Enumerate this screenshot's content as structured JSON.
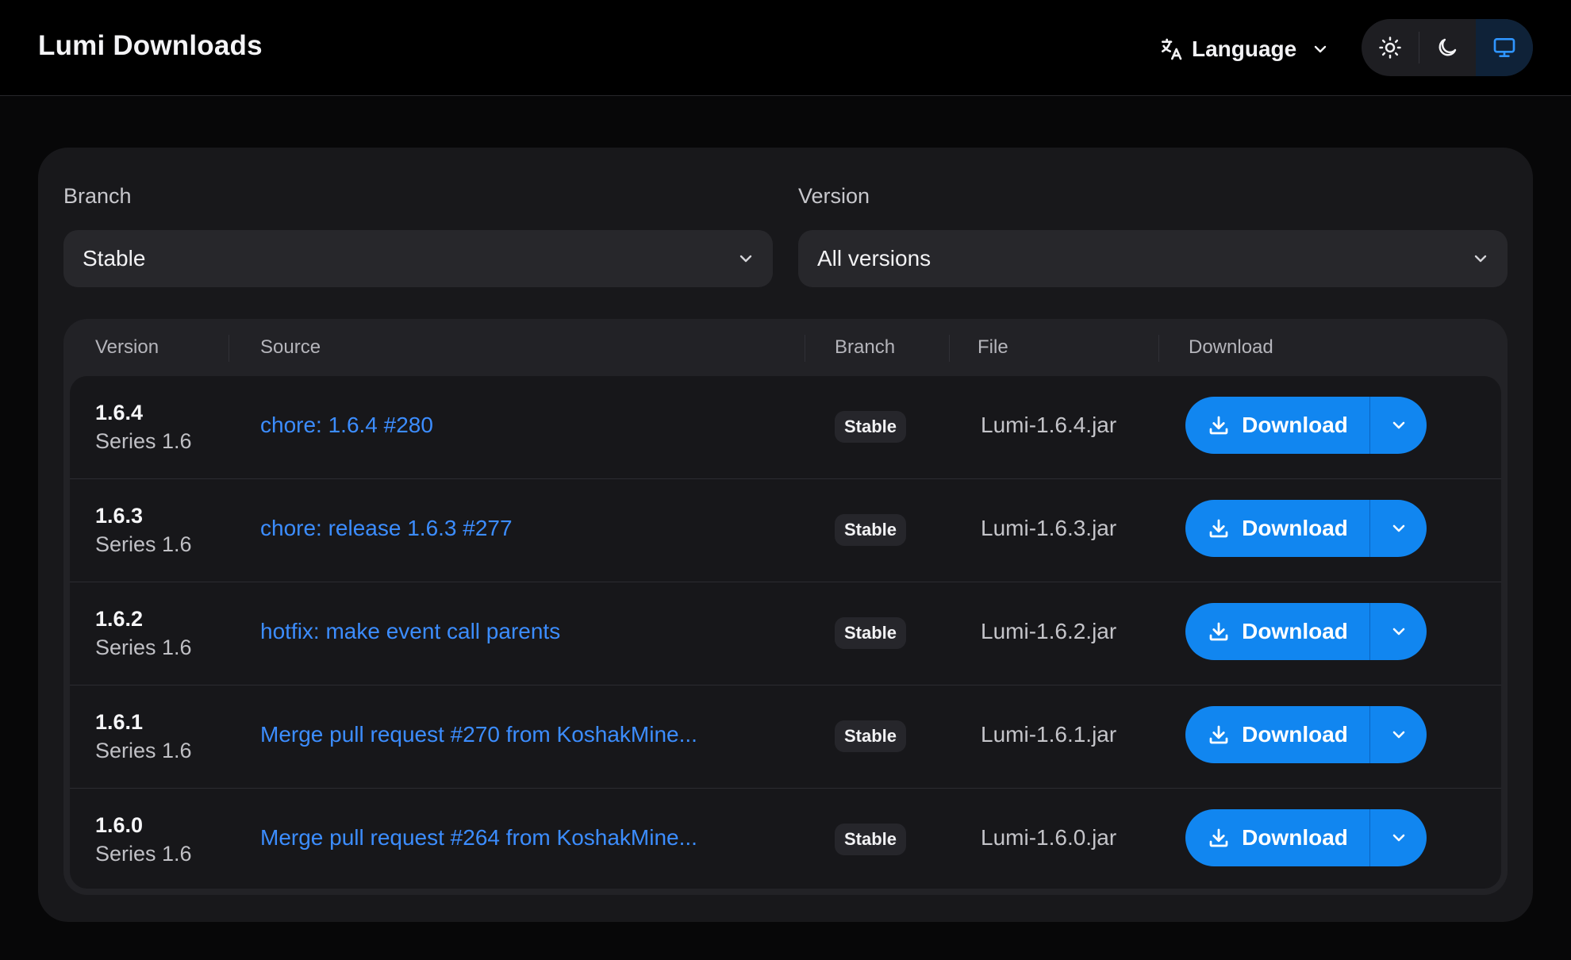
{
  "header": {
    "title": "Lumi Downloads",
    "language_label": "Language",
    "language_icon": "translate-icon",
    "theme_buttons": [
      {
        "name": "light",
        "icon": "sun-icon"
      },
      {
        "name": "dark",
        "icon": "moon-icon"
      },
      {
        "name": "system",
        "icon": "monitor-icon",
        "active": true
      }
    ]
  },
  "filters": {
    "branch": {
      "label": "Branch",
      "value": "Stable"
    },
    "version": {
      "label": "Version",
      "value": "All versions"
    }
  },
  "table": {
    "columns": [
      "Version",
      "Source",
      "Branch",
      "File",
      "Download"
    ],
    "rows": [
      {
        "version": "1.6.4",
        "series": "Series 1.6",
        "source": "chore: 1.6.4 #280",
        "branch": "Stable",
        "file": "Lumi-1.6.4.jar",
        "download_label": "Download"
      },
      {
        "version": "1.6.3",
        "series": "Series 1.6",
        "source": "chore: release 1.6.3 #277",
        "branch": "Stable",
        "file": "Lumi-1.6.3.jar",
        "download_label": "Download"
      },
      {
        "version": "1.6.2",
        "series": "Series 1.6",
        "source": "hotfix: make event call parents",
        "branch": "Stable",
        "file": "Lumi-1.6.2.jar",
        "download_label": "Download"
      },
      {
        "version": "1.6.1",
        "series": "Series 1.6",
        "source": "Merge pull request #270 from KoshakMine...",
        "branch": "Stable",
        "file": "Lumi-1.6.1.jar",
        "download_label": "Download"
      },
      {
        "version": "1.6.0",
        "series": "Series 1.6",
        "source": "Merge pull request #264 from KoshakMine...",
        "branch": "Stable",
        "file": "Lumi-1.6.0.jar",
        "download_label": "Download"
      }
    ]
  },
  "colors": {
    "accent": "#1186f0",
    "link": "#3c8dff",
    "background": "#070708",
    "card": "#18181b"
  }
}
